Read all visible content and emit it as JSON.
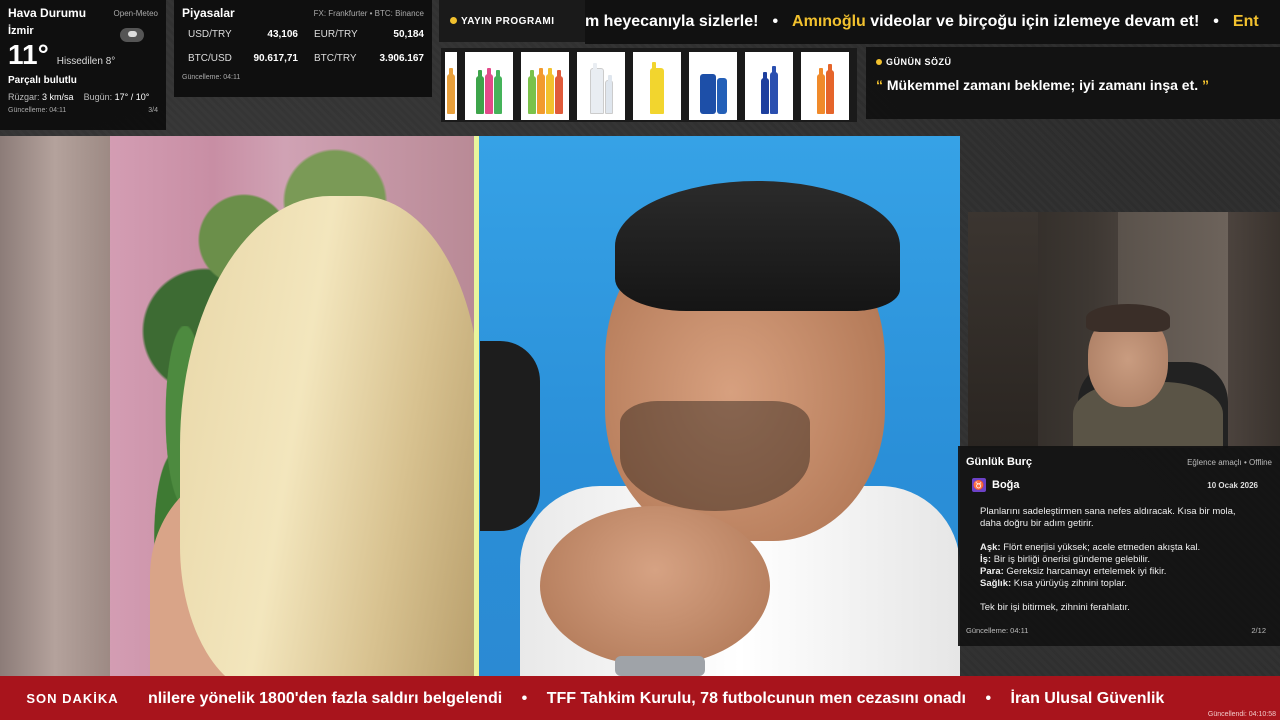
{
  "weather": {
    "title": "Hava Durumu",
    "source": "Open-Meteo",
    "city": "İzmir",
    "temperature": "11°",
    "feels_like": "Hissedilen 8°",
    "condition": "Parçalı bulutlu",
    "wind_label": "Rüzgar:",
    "wind_value": "3 km/sa",
    "today_label": "Bugün:",
    "today_value": "17° / 10°",
    "updated": "Güncelleme: 04:11",
    "page": "3/4",
    "icon": "partly-cloudy-icon"
  },
  "markets": {
    "title": "Piyasalar",
    "source": "FX: Frankfurter • BTC: Binance",
    "items": [
      {
        "name": "USD/TRY",
        "value": "43,106"
      },
      {
        "name": "EUR/TRY",
        "value": "50,184"
      },
      {
        "name": "BTC/USD",
        "value": "90.617,71"
      },
      {
        "name": "BTC/TRY",
        "value": "3.906.167"
      }
    ],
    "updated": "Güncelleme: 04:11"
  },
  "schedule": {
    "label": "YAYIN PROGRAMI"
  },
  "top_ticker": {
    "part1": "m heyecanıyla sizlerle!",
    "highlight": "Amınoğlu",
    "part2": "videolar ve birçoğu için izlemeye devam et!",
    "highlight2": "Ent"
  },
  "quote": {
    "label": "GÜNÜN SÖZÜ",
    "open_mark": "“",
    "text": "Mükemmel zamanı bekleme; iyi zamanı inşa et.",
    "close_mark": "”"
  },
  "horoscope": {
    "title": "Günlük Burç",
    "mode": "Eğlence amaçlı • Offline",
    "sign_icon": "♉",
    "sign": "Boğa",
    "date": "10 Ocak 2026",
    "intro": "Planlarını sadeleştirmen sana nefes aldıracak. Kısa bir mola, daha doğru bir adım getirir.",
    "love_label": "Aşk:",
    "love": "Flört enerjisi yüksek; acele etmeden akışta kal.",
    "work_label": "İş:",
    "work": "Bir iş birliği önerisi gündeme gelebilir.",
    "money_label": "Para:",
    "money": "Gereksiz harcamayı ertelemek iyi fikir.",
    "health_label": "Sağlık:",
    "health": "Kısa yürüyüş zihnini toplar.",
    "advice": "Tek bir işi bitirmek, zihnini ferahlatır.",
    "updated": "Güncelleme: 04:11",
    "page": "2/12"
  },
  "breaking": {
    "label": "SON DAKİKA",
    "item1": "nlilere yönelik 1800'den fazla saldırı belgelendi",
    "item2": "TFF Tahkim Kurulu, 78 futbolcunun men cezasını onadı",
    "item3": "İran Ulusal Güvenlik",
    "separator": "•",
    "updated": "Güncellendi: 04:10:58"
  },
  "colors": {
    "accent": "#f2c12e",
    "breaking_bg": "#a8141c",
    "sign_icon_bg": "#6d42c7"
  }
}
